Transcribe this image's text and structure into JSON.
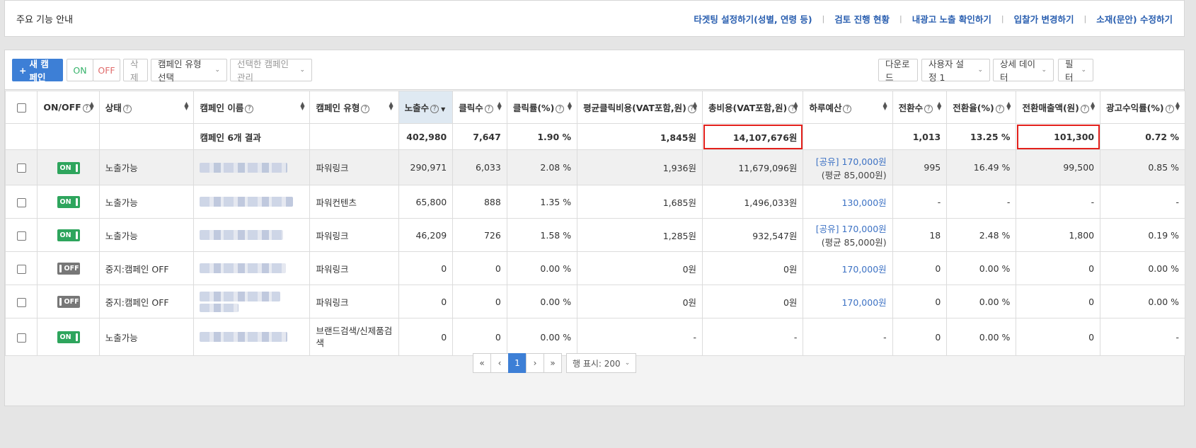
{
  "notice": {
    "title": "주요 기능 안내",
    "links": [
      "타겟팅 설정하기(성별, 연령 등)",
      "검토 진행 현황",
      "내광고 노출 확인하기",
      "입찰가 변경하기",
      "소재(문안) 수정하기"
    ],
    "separator": "|"
  },
  "toolbar": {
    "new_campaign": "새 캠페인",
    "new_campaign_icon": "+",
    "on": "ON",
    "off": "OFF",
    "delete": "삭제",
    "campaign_type_select": "캠페인 유형 선택",
    "manage_selected": "선택한 캠페인 관리",
    "download": "다운로드",
    "user_setting": "사용자 설정 1",
    "detail_data": "상세 데이터",
    "filter": "필터",
    "chevron": "⌄"
  },
  "table": {
    "headers": {
      "onoff": "ON/OFF",
      "status": "상태",
      "name": "캠페인 이름",
      "type": "캠페인 유형",
      "impressions": "노출수",
      "clicks": "클릭수",
      "ctr": "클릭률(%)",
      "cpc": "평균클릭비용(VAT포함,원)",
      "cost": "총비용(VAT포함,원)",
      "budget": "하루예산",
      "conversions": "전환수",
      "conv_rate": "전환율(%)",
      "conv_revenue": "전환매출액(원)",
      "roas": "광고수익률(%)"
    },
    "summary": {
      "label": "캠페인 6개 결과",
      "impressions": "402,980",
      "clicks": "7,647",
      "ctr": "1.90 %",
      "cpc": "1,845원",
      "cost": "14,107,676원",
      "conversions": "1,013",
      "conv_rate": "13.25 %",
      "conv_revenue": "101,300",
      "roas": "0.72 %"
    },
    "rows": [
      {
        "toggle": "ON",
        "status": "노출가능",
        "type": "파워링크",
        "impressions": "290,971",
        "clicks": "6,033",
        "ctr": "2.08 %",
        "cpc": "1,936원",
        "cost": "11,679,096원",
        "budget": "[공유] 170,000원",
        "budget_sub": "(평균 85,000원)",
        "conversions": "995",
        "conv_rate": "16.49 %",
        "conv_revenue": "99,500",
        "roas": "0.85 %"
      },
      {
        "toggle": "ON",
        "status": "노출가능",
        "type": "파워컨텐츠",
        "impressions": "65,800",
        "clicks": "888",
        "ctr": "1.35 %",
        "cpc": "1,685원",
        "cost": "1,496,033원",
        "budget": "130,000원",
        "budget_sub": "",
        "conversions": "-",
        "conv_rate": "-",
        "conv_revenue": "-",
        "roas": "-"
      },
      {
        "toggle": "ON",
        "status": "노출가능",
        "type": "파워링크",
        "impressions": "46,209",
        "clicks": "726",
        "ctr": "1.58 %",
        "cpc": "1,285원",
        "cost": "932,547원",
        "budget": "[공유] 170,000원",
        "budget_sub": "(평균 85,000원)",
        "conversions": "18",
        "conv_rate": "2.48 %",
        "conv_revenue": "1,800",
        "roas": "0.19 %"
      },
      {
        "toggle": "OFF",
        "status": "중지:캠페인 OFF",
        "type": "파워링크",
        "impressions": "0",
        "clicks": "0",
        "ctr": "0.00 %",
        "cpc": "0원",
        "cost": "0원",
        "budget": "170,000원",
        "budget_sub": "",
        "conversions": "0",
        "conv_rate": "0.00 %",
        "conv_revenue": "0",
        "roas": "0.00 %"
      },
      {
        "toggle": "OFF",
        "status": "중지:캠페인 OFF",
        "type": "파워링크",
        "impressions": "0",
        "clicks": "0",
        "ctr": "0.00 %",
        "cpc": "0원",
        "cost": "0원",
        "budget": "170,000원",
        "budget_sub": "",
        "conversions": "0",
        "conv_rate": "0.00 %",
        "conv_revenue": "0",
        "roas": "0.00 %"
      },
      {
        "toggle": "ON",
        "status": "노출가능",
        "type": "브랜드검색/신제품검색",
        "impressions": "0",
        "clicks": "0",
        "ctr": "0.00 %",
        "cpc": "-",
        "cost": "-",
        "budget": "-",
        "budget_sub": "",
        "conversions": "0",
        "conv_rate": "0.00 %",
        "conv_revenue": "0",
        "roas": "-"
      }
    ]
  },
  "pagination": {
    "first": "«",
    "prev": "‹",
    "current": "1",
    "next": "›",
    "last": "»",
    "rows_per_page": "행 표시: 200"
  },
  "colors": {
    "accent": "#3d7fd6",
    "on": "#2ea55d",
    "off": "#777777",
    "highlight": "#e3201b",
    "link": "#2a5fb0"
  }
}
